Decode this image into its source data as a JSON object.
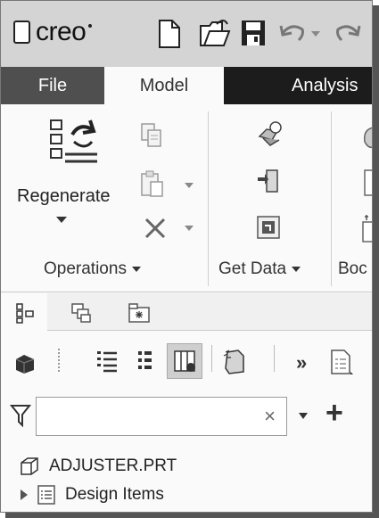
{
  "app": {
    "logo_text": "creo"
  },
  "ribbon_tabs": [
    {
      "label": "File"
    },
    {
      "label": "Model"
    },
    {
      "label": "Analysis"
    }
  ],
  "ribbon": {
    "regenerate_label": "Regenerate",
    "groups": [
      {
        "label": "Operations"
      },
      {
        "label": "Get Data"
      },
      {
        "label": "Boc"
      }
    ]
  },
  "filter": {
    "value": "",
    "clear_symbol": "×",
    "add_symbol": "+"
  },
  "toolbar": {
    "more_symbol": "»"
  },
  "tree": {
    "root": {
      "label": "ADJUSTER.PRT"
    },
    "items": [
      {
        "label": "Design Items"
      }
    ]
  },
  "colors": {
    "title_bar": "#d4d4d4",
    "tab_bar": "#1c1c1c",
    "file_tab": "#4f4f4f",
    "ribbon_bg": "#fafafa"
  }
}
